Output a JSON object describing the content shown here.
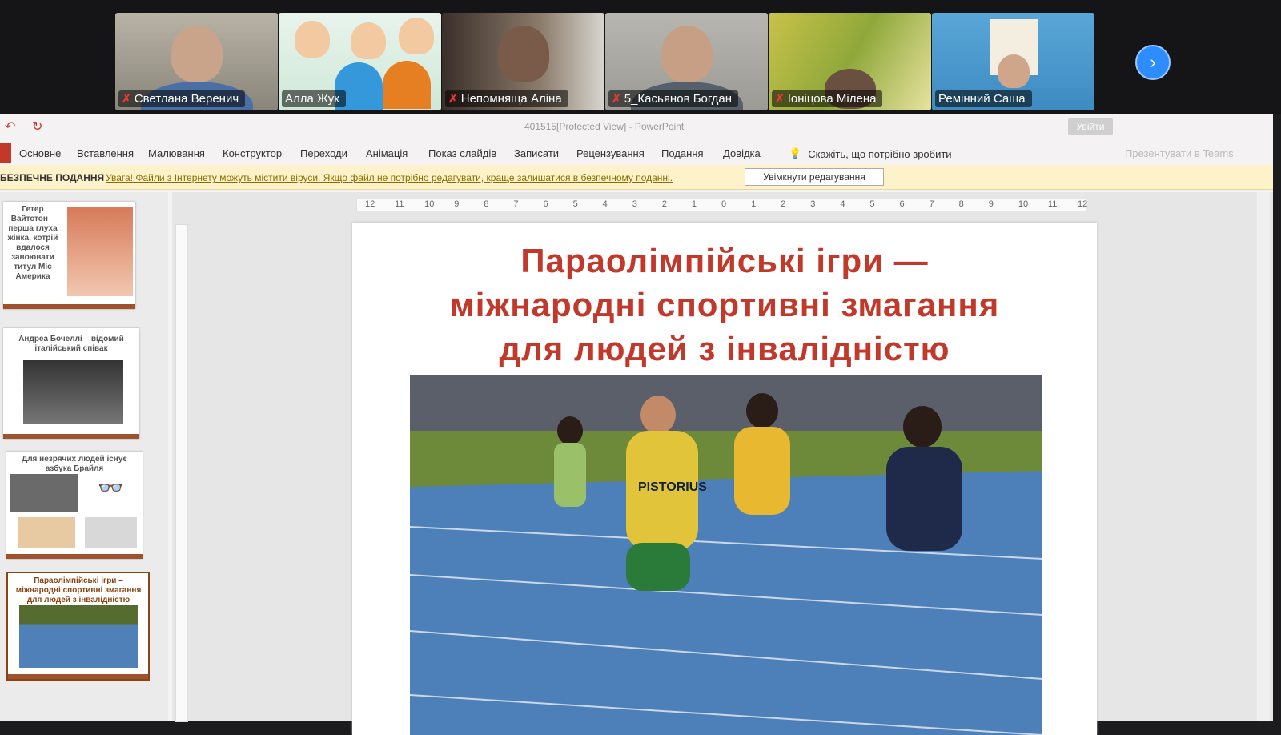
{
  "participants": [
    {
      "name": "Светлана Веренич",
      "muted": true
    },
    {
      "name": "Алла Жук",
      "muted": false,
      "active": true
    },
    {
      "name": "Непомняща Аліна",
      "muted": true
    },
    {
      "name": "5_Касьянов Богдан",
      "muted": true
    },
    {
      "name": "Іоніцова Мілена",
      "muted": true
    },
    {
      "name": "Ремінний Саша",
      "muted": false
    }
  ],
  "window": {
    "title": "401515[Protected View] - PowerPoint",
    "login": "Увійти"
  },
  "ribbon": {
    "tabs": [
      "Основне",
      "Вставлення",
      "Малювання",
      "Конструктор",
      "Переходи",
      "Анімація",
      "Показ слайдів",
      "Записати",
      "Рецензування",
      "Подання",
      "Довідка"
    ],
    "tell_me": "Скажіть, що потрібно зробити",
    "share": "Презентувати в Teams"
  },
  "protected_view": {
    "label": "БЕЗПЕЧНЕ ПОДАННЯ",
    "message": "Увага! Файли з Інтернету можуть містити віруси. Якщо файл не потрібно редагувати, краще залишатися в безпечному поданні.",
    "enable_button": "Увімкнути редагування"
  },
  "ruler": [
    "12",
    "11",
    "10",
    "9",
    "8",
    "7",
    "6",
    "5",
    "4",
    "3",
    "2",
    "1",
    "0",
    "1",
    "2",
    "3",
    "4",
    "5",
    "6",
    "7",
    "8",
    "9",
    "10",
    "11",
    "12"
  ],
  "thumbnails": [
    {
      "text": "Гетер Вайтстон – перша глуха жінка, котрій вдалося завоювати титул Міс Америка"
    },
    {
      "text": "Андреа Бочеллі – відомий італійський співак"
    },
    {
      "text": "Для незрячих людей існує азбука Брайля"
    },
    {
      "text": "Параолімпійські ігри – міжнародні спортивні змагання для людей з інвалідністю",
      "selected": true
    }
  ],
  "slide": {
    "title_lines": [
      "Параолімпійські ігри —",
      "міжнародні спортивні змагання",
      "для людей з інвалідністю"
    ]
  },
  "colors": {
    "accent": "#c0392b",
    "warning_bg": "#fdf2c9",
    "zoom_blue": "#2d8cff"
  }
}
